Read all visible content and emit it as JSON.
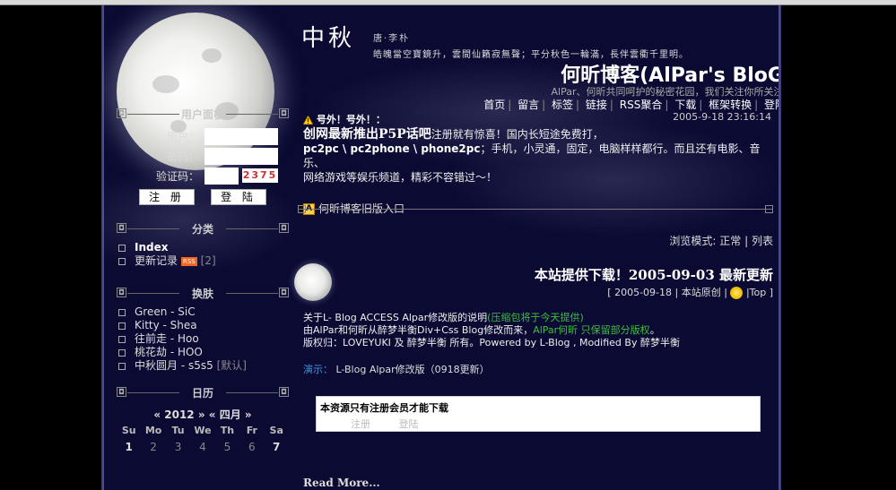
{
  "header": {
    "poem_title": "中秋",
    "poem_author": "唐·李朴",
    "poem_line": "皓魄當空寶鏡升，雲間仙籟寂無聲；平分秋色一輪滿，長伴雲衢千里明。",
    "blog_title": "何昕博客(AlPar's BloG)",
    "blog_subtitle": "AlPar、何昕共同呵护的秘密花园，我们关注你所关注...",
    "nav": [
      "首页",
      "留言",
      "标签",
      "链接",
      "RSS聚合",
      "下载",
      "框架转换",
      "登陆"
    ]
  },
  "sidebar": {
    "login": {
      "title": "用户面板",
      "user_label": "用户：",
      "pass_label": "密码：",
      "code_label": "验证码：",
      "captcha": "2375",
      "register_button": "注 册",
      "login_button": "登 陆"
    },
    "category": {
      "title": "分类",
      "items": [
        {
          "label": "Index"
        },
        {
          "label": "更新记录",
          "badge": "RSS",
          "count": "[2]"
        }
      ]
    },
    "skins": {
      "title": "换肤",
      "items": [
        {
          "label": "Green - SiC"
        },
        {
          "label": "Kitty - Shea"
        },
        {
          "label": "往前走 - Hoo"
        },
        {
          "label": "桃花劫 - HOO"
        },
        {
          "label": "中秋圆月 - s5s5",
          "extra": "[默认]"
        }
      ]
    },
    "calendar": {
      "title": "日历",
      "year_nav": "« 2012 »",
      "month_nav": "« 四月 »",
      "weekdays": [
        "Su",
        "Mo",
        "Tu",
        "We",
        "Th",
        "Fr",
        "Sa"
      ],
      "days": [
        "1",
        "2",
        "3",
        "4",
        "5",
        "6",
        "7"
      ]
    }
  },
  "notice": {
    "date": "2005-9-18 23:16:14",
    "headline": "号外！号外！：",
    "big_text": "创网最新推出P5P话吧",
    "line1_rest": "注册就有惊喜！国内长短途免费打，",
    "line2_bold": "pc2pc \\ pc2phone \\ phone2pc",
    "line2_rest": "；手机，小灵通，固定，电脑样样都行。而且还有电影、音乐、",
    "line3": "网络游戏等娱乐频道，精彩不容错过～！",
    "old_entry": "何昕博客旧版入口",
    "a_icon": "A"
  },
  "view_mode": {
    "label": "浏览模式:",
    "normal": "正常",
    "sep": "|",
    "list": "列表"
  },
  "post": {
    "title": "本站提供下载！2005-09-03 最新更新",
    "date": "[ 2005-09-18",
    "sep1": "|",
    "category": "本站原创",
    "sep2": "|",
    "top": "|Top ]",
    "body_line1_a": "关于L- Blog ACCESS Alpar修改版的说明",
    "body_line1_b": "(压缩包将于今天提供)",
    "body_line2_a": "由AlPar和何昕从醉梦半衡Div+Css Blog修改而来，",
    "body_line2_b": "AlPar何昕 只保留部分版权",
    "body_line2_c": "。",
    "body_line3": "版权归：LOVEYUKI 及 醉梦半衡  所有。Powered by L-Blog , Modified By 醉梦半衡",
    "demo_label": "演示：",
    "demo_text": "L-Blog Alpar修改版（0918更新）",
    "download_heading": "本资源只有注册会员才能下载",
    "download_register": "注册",
    "download_login": "登陆",
    "read_more": "Read More..."
  },
  "colors": {
    "page_bg": "#0a0a33",
    "outer_bg": "#000000",
    "green_text": "#3fbf3f",
    "link_blue": "#4a90d9",
    "rss_badge": "#f26522"
  }
}
